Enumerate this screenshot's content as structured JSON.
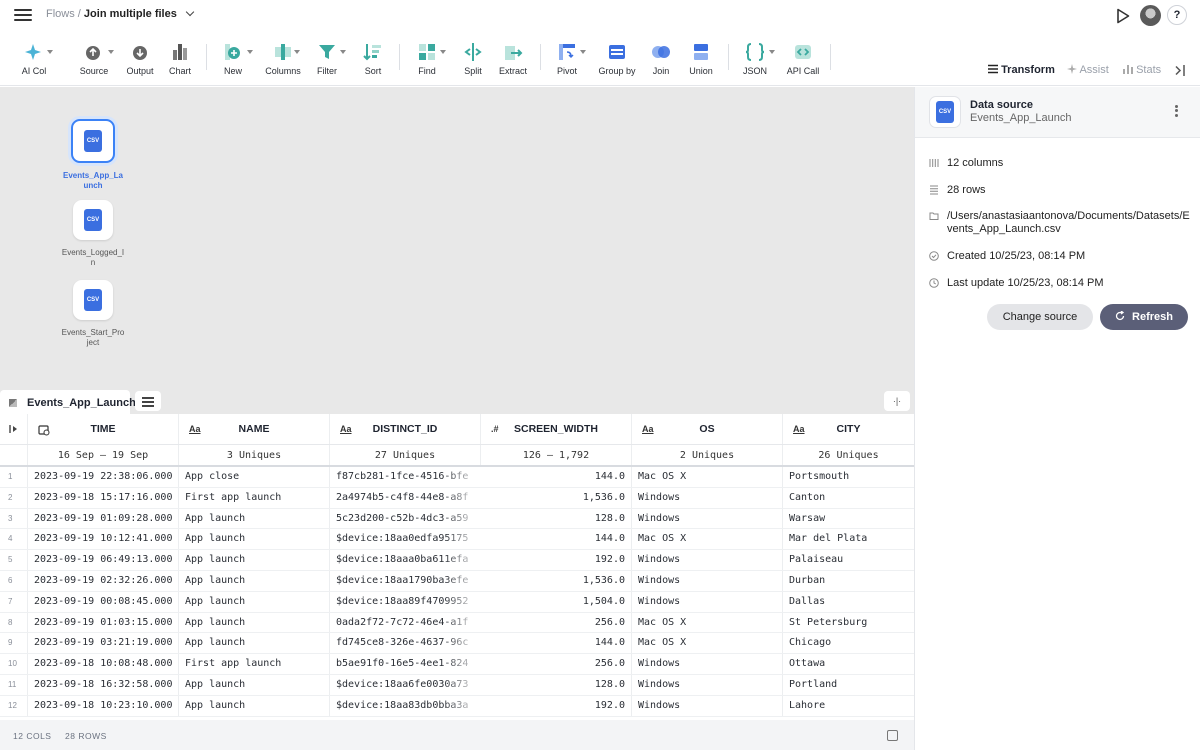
{
  "breadcrumb": {
    "root": "Flows",
    "separator": "/",
    "current": "Join multiple files"
  },
  "toolbar": {
    "ai_col": "AI Col",
    "source": "Source",
    "output": "Output",
    "chart": "Chart",
    "new": "New",
    "columns": "Columns",
    "filter": "Filter",
    "sort": "Sort",
    "find": "Find",
    "split": "Split",
    "extract": "Extract",
    "pivot": "Pivot",
    "group_by": "Group by",
    "join": "Join",
    "union": "Union",
    "json": "JSON",
    "api_call": "API Call"
  },
  "panel_tabs": {
    "transform": "Transform",
    "assist": "Assist",
    "stats": "Stats"
  },
  "help_label": "?",
  "nodes": [
    {
      "name": "Events_App_Launch",
      "icon_text": "CSV"
    },
    {
      "name": "Events_Logged_In",
      "icon_text": "CSV"
    },
    {
      "name": "Events_Start_Project",
      "icon_text": "CSV"
    }
  ],
  "sheet_tab": "Events_App_Launch",
  "collapse_label": "·|·",
  "columns": [
    {
      "type": "",
      "name": "TIME",
      "stat": "16 Sep — 19 Sep"
    },
    {
      "type": "Aa",
      "name": "NAME",
      "stat": "3 Uniques"
    },
    {
      "type": "Aa",
      "name": "DISTINCT_ID",
      "stat": "27 Uniques"
    },
    {
      "type": ".#",
      "name": "SCREEN_WIDTH",
      "stat": "126 — 1,792"
    },
    {
      "type": "Aa",
      "name": "OS",
      "stat": "2 Uniques"
    },
    {
      "type": "Aa",
      "name": "CITY",
      "stat": "26 Uniques"
    }
  ],
  "rows": [
    [
      "1",
      "2023-09-19 22:38:06.000",
      "App close",
      "f87cb281-1fce-4516-bfe",
      "144.0",
      "Mac OS X",
      "Portsmouth"
    ],
    [
      "2",
      "2023-09-18 15:17:16.000",
      "First app launch",
      "2a4974b5-c4f8-44e8-a8f",
      "1,536.0",
      "Windows",
      "Canton"
    ],
    [
      "3",
      "2023-09-19 01:09:28.000",
      "App launch",
      "5c23d200-c52b-4dc3-a59",
      "128.0",
      "Windows",
      "Warsaw"
    ],
    [
      "4",
      "2023-09-19 10:12:41.000",
      "App launch",
      "$device:18aa0edfa95175",
      "144.0",
      "Mac OS X",
      "Mar del Plata"
    ],
    [
      "5",
      "2023-09-19 06:49:13.000",
      "App launch",
      "$device:18aaa0ba611efa",
      "192.0",
      "Windows",
      "Palaiseau"
    ],
    [
      "6",
      "2023-09-19 02:32:26.000",
      "App launch",
      "$device:18aa1790ba3efe",
      "1,536.0",
      "Windows",
      "Durban"
    ],
    [
      "7",
      "2023-09-19 00:08:45.000",
      "App launch",
      "$device:18aa89f4709952",
      "1,504.0",
      "Windows",
      "Dallas"
    ],
    [
      "8",
      "2023-09-19 01:03:15.000",
      "App launch",
      "0ada2f72-7c72-46e4-a1f",
      "256.0",
      "Mac OS X",
      "St Petersburg"
    ],
    [
      "9",
      "2023-09-19 03:21:19.000",
      "App launch",
      "fd745ce8-326e-4637-96c",
      "144.0",
      "Mac OS X",
      "Chicago"
    ],
    [
      "10",
      "2023-09-18 10:08:48.000",
      "First app launch",
      "b5ae91f0-16e5-4ee1-824",
      "256.0",
      "Windows",
      "Ottawa"
    ],
    [
      "11",
      "2023-09-18 16:32:58.000",
      "App launch",
      "$device:18aa6fe0030a73",
      "128.0",
      "Windows",
      "Portland"
    ],
    [
      "12",
      "2023-09-18 10:23:10.000",
      "App launch",
      "$device:18aa83db0bba3a",
      "192.0",
      "Windows",
      "Lahore"
    ]
  ],
  "footer": {
    "cols": "12 COLS",
    "rows": "28 ROWS"
  },
  "right_panel": {
    "title": "Data source",
    "subtitle": "Events_App_Launch",
    "icon_text": "CSV",
    "columns": "12 columns",
    "rows": "28 rows",
    "path": "/Users/anastasiaantonova/Documents/Datasets/Events_App_Launch.csv",
    "created": "Created 10/25/23, 08:14 PM",
    "updated": "Last update 10/25/23, 08:14 PM",
    "change_source": "Change source",
    "refresh": "Refresh"
  },
  "colors": {
    "accent": "#3b82f6",
    "csv_blue": "#3b6fe0",
    "teal": "#3aa99f",
    "refresh_bg": "#5b5f78"
  }
}
